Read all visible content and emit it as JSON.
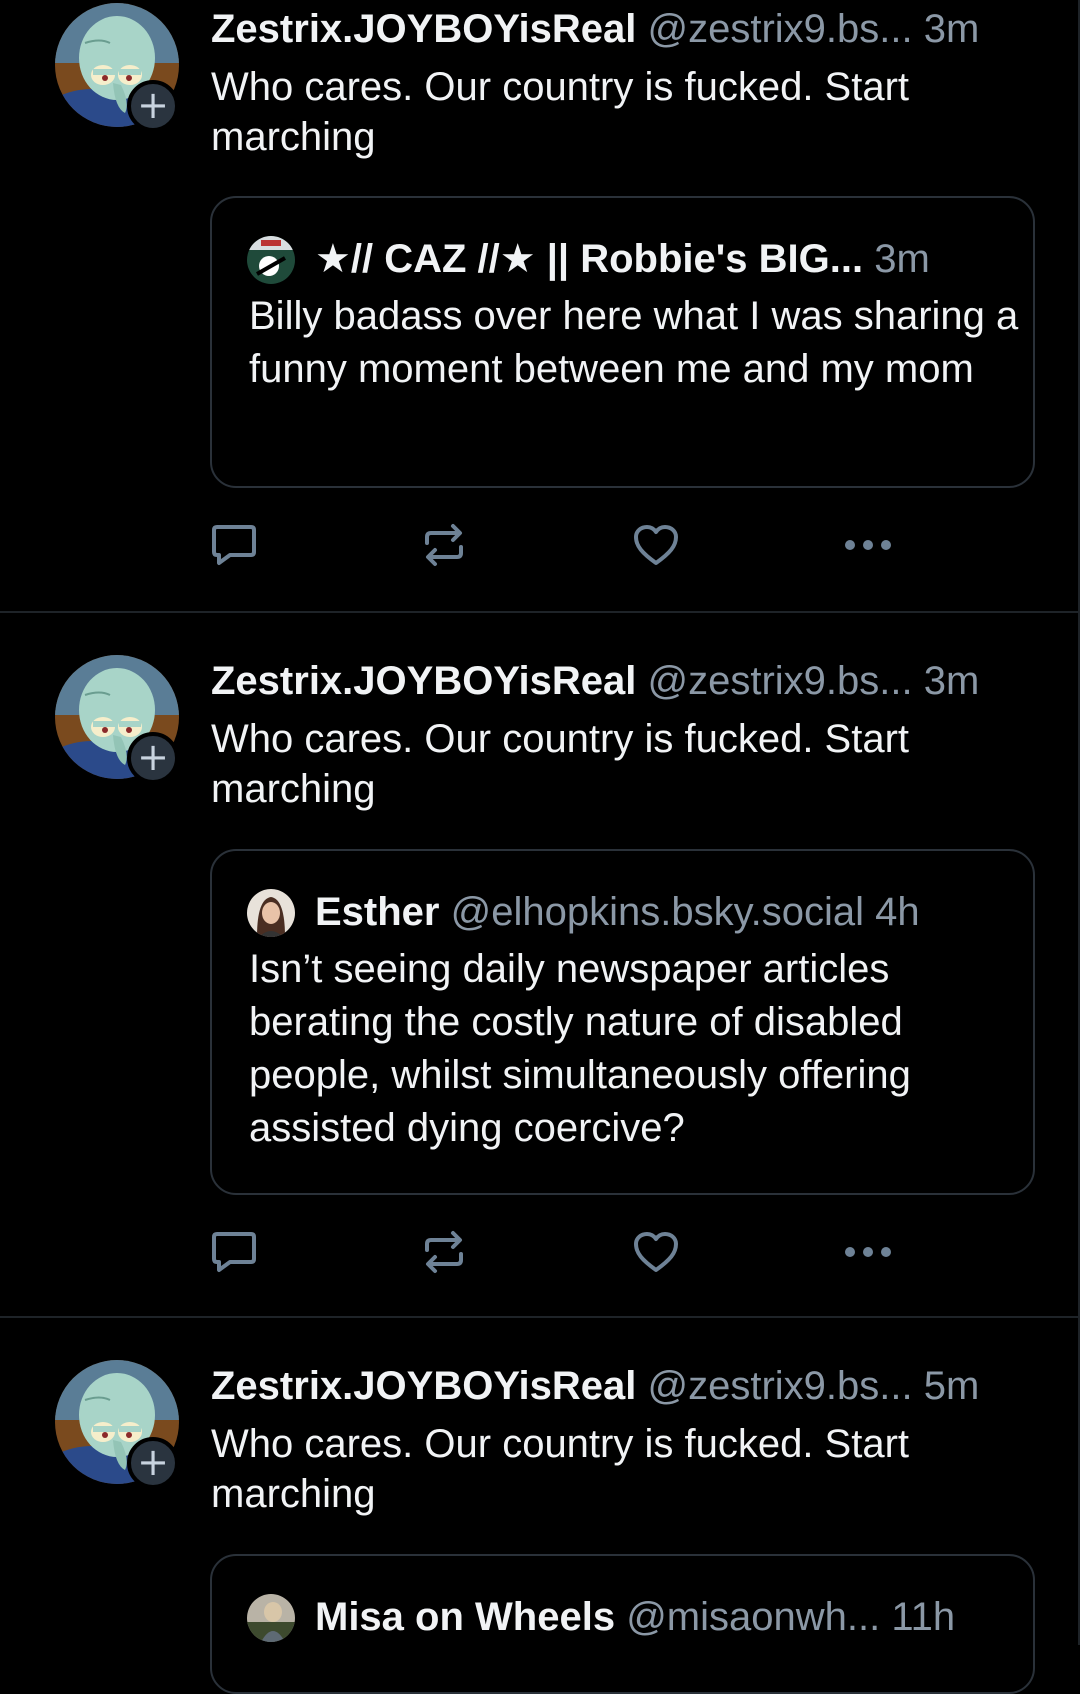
{
  "posts": [
    {
      "author": {
        "display_name": "Zestrix.JOYBOYisReal",
        "handle": "@zestrix9.bs...",
        "avatar_icon": "squidward-avatar-icon"
      },
      "time": "3m",
      "text": "Who cares. Our country is fucked. Start marching",
      "quote": {
        "display_name": "★// CAZ //★ || Robbie's BIG...",
        "handle": "",
        "time": "3m",
        "avatar_icon": "hockey-avatar-icon",
        "text": "Billy badass over here what I was sharing a funny moment between me and my mom"
      }
    },
    {
      "author": {
        "display_name": "Zestrix.JOYBOYisReal",
        "handle": "@zestrix9.bs...",
        "avatar_icon": "squidward-avatar-icon"
      },
      "time": "3m",
      "text": "Who cares. Our country is fucked. Start marching",
      "quote": {
        "display_name": "Esther",
        "handle": "@elhopkins.bsky.social",
        "time": "4h",
        "avatar_icon": "portrait-avatar-icon",
        "text": "Isn’t seeing daily newspaper articles berating the costly nature of disabled people, whilst simultaneously offering assisted dying coercive?"
      }
    },
    {
      "author": {
        "display_name": "Zestrix.JOYBOYisReal",
        "handle": "@zestrix9.bs...",
        "avatar_icon": "squidward-avatar-icon"
      },
      "time": "5m",
      "text": "Who cares. Our country is fucked. Start marching",
      "quote": {
        "display_name": "Misa on Wheels",
        "handle": "@misaonwh...",
        "time": "11h",
        "avatar_icon": "photo-avatar-icon",
        "text": ""
      }
    }
  ],
  "icons": {
    "reply": "reply-icon",
    "repost": "repost-icon",
    "like": "heart-icon",
    "more": "more-options-icon",
    "follow": "plus-icon"
  },
  "follow_badge_glyph": "+",
  "colors": {
    "background": "#000000",
    "text_primary": "#f1f3f5",
    "text_secondary": "#8b98a6",
    "border": "#2a3139",
    "icon": "#6e8296",
    "follow_badge": "#2a343f"
  }
}
